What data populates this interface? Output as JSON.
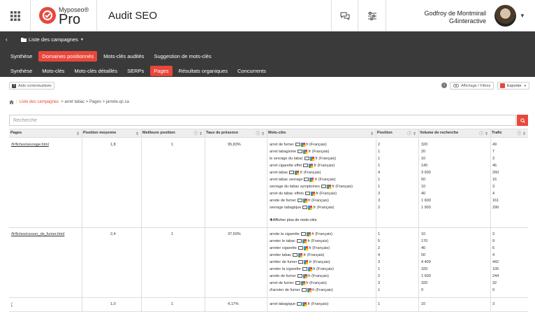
{
  "header": {
    "brand_small": "Myposeo®",
    "brand_pro": "Pro",
    "title": "Audit SEO",
    "user_name": "Godfroy de Montmirail",
    "user_company": "G4interactive"
  },
  "nav": {
    "back": "‹",
    "campaigns": "Liste des campagnes",
    "primary": [
      "Synthèse",
      "Domaines positionnés",
      "Mots-clés audités",
      "Suggestion de mots-clés"
    ],
    "primary_active": 1,
    "secondary": [
      "Synthèse",
      "Mots-clés",
      "Mots-clés détaillés",
      "SERPs",
      "Pages",
      "Résultats organiques",
      "Concurrents"
    ],
    "secondary_active": 4
  },
  "toolbar": {
    "help": "Aide contextualisée",
    "filters": "Affichage / Filtres",
    "export": "Exporter"
  },
  "breadcrumb": {
    "link": "Liste des campagnes",
    "rest": "> arret tabac > Pages > jarrete.qc.ca"
  },
  "search": {
    "placeholder": "Recherche"
  },
  "table": {
    "headers": [
      "Pages",
      "Position moyenne",
      "Meilleure position",
      "Taux de présence",
      "Mots-clés",
      "Position",
      "Volume de recherche",
      "Trafic"
    ],
    "more_label": "Afficher plus de mots-clés",
    "lang": ".fr (Français)",
    "rows": [
      {
        "page": "/fr/fiches/sevrage.html",
        "avg": "1,8",
        "best": "1",
        "rate": "95,83%",
        "keywords": [
          "arret de fumer",
          "arret tabagisme",
          "le sevrage du tabac",
          "arret cigarette effet",
          "arret tabac",
          "arret tabac sevrage",
          "sevrage du tabac symptomes",
          "arret du tabac effets",
          "arrete de fumer",
          "sevrage tabagique"
        ],
        "positions": [
          "2",
          "1",
          "1",
          "1",
          "4",
          "1",
          "1",
          "3",
          "3",
          "2"
        ],
        "volumes": [
          "320",
          "20",
          "10",
          "140",
          "3 600",
          "50",
          "10",
          "40",
          "1 600",
          "1 900"
        ],
        "traffic": [
          "49",
          "7",
          "3",
          "46",
          "260",
          "16",
          "3",
          "4",
          "161",
          "290"
        ],
        "more": true
      },
      {
        "page": "/fr/fiches/cesser_de_fumer.html",
        "avg": "2,4",
        "best": "1",
        "rate": "37,50%",
        "keywords": [
          "arrete la cigarette",
          "arreter le tabac",
          "arreter cigarette",
          "arreter tabac",
          "arrêter de fumer",
          "arreter la cigarette",
          "arrete de fumer",
          "arret de fumer",
          "d'arreter de fumer"
        ],
        "positions": [
          "1",
          "5",
          "2",
          "4",
          "3",
          "1",
          "2",
          "3",
          "1"
        ],
        "volumes": [
          "10",
          "170",
          "40",
          "50",
          "4 400",
          "320",
          "1 600",
          "320",
          "0"
        ],
        "traffic": [
          "3",
          "9",
          "6",
          "4",
          "442",
          "105",
          "244",
          "32",
          "0"
        ],
        "more": false
      },
      {
        "page": "/",
        "avg": "1,0",
        "best": "1",
        "rate": "4,17%",
        "keywords": [
          "arret tabagique"
        ],
        "positions": [
          "1"
        ],
        "volumes": [
          "10"
        ],
        "traffic": [
          "3"
        ],
        "more": false
      }
    ]
  },
  "colors": {
    "accent": "#e8473b",
    "dark_bar": "#3a3a3a"
  }
}
